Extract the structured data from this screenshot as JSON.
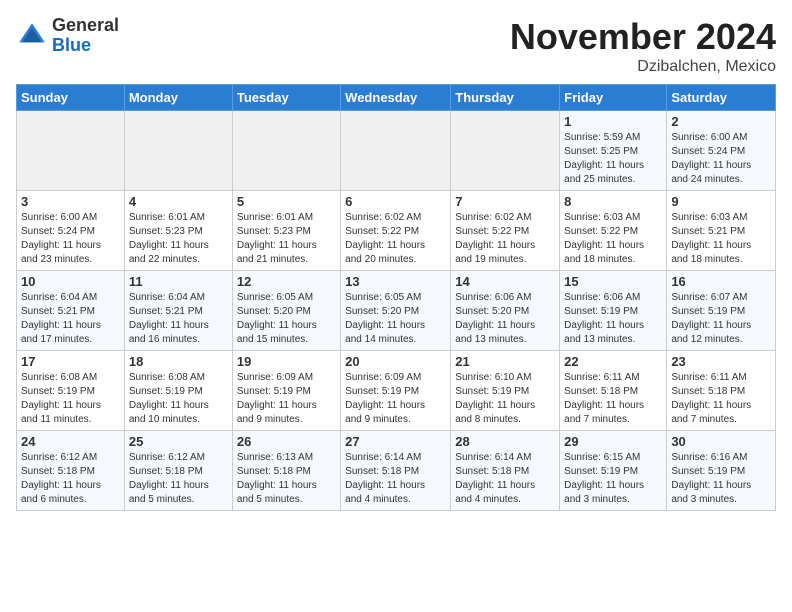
{
  "logo": {
    "general": "General",
    "blue": "Blue"
  },
  "title": "November 2024",
  "location": "Dzibalchen, Mexico",
  "days_header": [
    "Sunday",
    "Monday",
    "Tuesday",
    "Wednesday",
    "Thursday",
    "Friday",
    "Saturday"
  ],
  "weeks": [
    [
      {
        "day": "",
        "info": ""
      },
      {
        "day": "",
        "info": ""
      },
      {
        "day": "",
        "info": ""
      },
      {
        "day": "",
        "info": ""
      },
      {
        "day": "",
        "info": ""
      },
      {
        "day": "1",
        "info": "Sunrise: 5:59 AM\nSunset: 5:25 PM\nDaylight: 11 hours\nand 25 minutes."
      },
      {
        "day": "2",
        "info": "Sunrise: 6:00 AM\nSunset: 5:24 PM\nDaylight: 11 hours\nand 24 minutes."
      }
    ],
    [
      {
        "day": "3",
        "info": "Sunrise: 6:00 AM\nSunset: 5:24 PM\nDaylight: 11 hours\nand 23 minutes."
      },
      {
        "day": "4",
        "info": "Sunrise: 6:01 AM\nSunset: 5:23 PM\nDaylight: 11 hours\nand 22 minutes."
      },
      {
        "day": "5",
        "info": "Sunrise: 6:01 AM\nSunset: 5:23 PM\nDaylight: 11 hours\nand 21 minutes."
      },
      {
        "day": "6",
        "info": "Sunrise: 6:02 AM\nSunset: 5:22 PM\nDaylight: 11 hours\nand 20 minutes."
      },
      {
        "day": "7",
        "info": "Sunrise: 6:02 AM\nSunset: 5:22 PM\nDaylight: 11 hours\nand 19 minutes."
      },
      {
        "day": "8",
        "info": "Sunrise: 6:03 AM\nSunset: 5:22 PM\nDaylight: 11 hours\nand 18 minutes."
      },
      {
        "day": "9",
        "info": "Sunrise: 6:03 AM\nSunset: 5:21 PM\nDaylight: 11 hours\nand 18 minutes."
      }
    ],
    [
      {
        "day": "10",
        "info": "Sunrise: 6:04 AM\nSunset: 5:21 PM\nDaylight: 11 hours\nand 17 minutes."
      },
      {
        "day": "11",
        "info": "Sunrise: 6:04 AM\nSunset: 5:21 PM\nDaylight: 11 hours\nand 16 minutes."
      },
      {
        "day": "12",
        "info": "Sunrise: 6:05 AM\nSunset: 5:20 PM\nDaylight: 11 hours\nand 15 minutes."
      },
      {
        "day": "13",
        "info": "Sunrise: 6:05 AM\nSunset: 5:20 PM\nDaylight: 11 hours\nand 14 minutes."
      },
      {
        "day": "14",
        "info": "Sunrise: 6:06 AM\nSunset: 5:20 PM\nDaylight: 11 hours\nand 13 minutes."
      },
      {
        "day": "15",
        "info": "Sunrise: 6:06 AM\nSunset: 5:19 PM\nDaylight: 11 hours\nand 13 minutes."
      },
      {
        "day": "16",
        "info": "Sunrise: 6:07 AM\nSunset: 5:19 PM\nDaylight: 11 hours\nand 12 minutes."
      }
    ],
    [
      {
        "day": "17",
        "info": "Sunrise: 6:08 AM\nSunset: 5:19 PM\nDaylight: 11 hours\nand 11 minutes."
      },
      {
        "day": "18",
        "info": "Sunrise: 6:08 AM\nSunset: 5:19 PM\nDaylight: 11 hours\nand 10 minutes."
      },
      {
        "day": "19",
        "info": "Sunrise: 6:09 AM\nSunset: 5:19 PM\nDaylight: 11 hours\nand 9 minutes."
      },
      {
        "day": "20",
        "info": "Sunrise: 6:09 AM\nSunset: 5:19 PM\nDaylight: 11 hours\nand 9 minutes."
      },
      {
        "day": "21",
        "info": "Sunrise: 6:10 AM\nSunset: 5:19 PM\nDaylight: 11 hours\nand 8 minutes."
      },
      {
        "day": "22",
        "info": "Sunrise: 6:11 AM\nSunset: 5:18 PM\nDaylight: 11 hours\nand 7 minutes."
      },
      {
        "day": "23",
        "info": "Sunrise: 6:11 AM\nSunset: 5:18 PM\nDaylight: 11 hours\nand 7 minutes."
      }
    ],
    [
      {
        "day": "24",
        "info": "Sunrise: 6:12 AM\nSunset: 5:18 PM\nDaylight: 11 hours\nand 6 minutes."
      },
      {
        "day": "25",
        "info": "Sunrise: 6:12 AM\nSunset: 5:18 PM\nDaylight: 11 hours\nand 5 minutes."
      },
      {
        "day": "26",
        "info": "Sunrise: 6:13 AM\nSunset: 5:18 PM\nDaylight: 11 hours\nand 5 minutes."
      },
      {
        "day": "27",
        "info": "Sunrise: 6:14 AM\nSunset: 5:18 PM\nDaylight: 11 hours\nand 4 minutes."
      },
      {
        "day": "28",
        "info": "Sunrise: 6:14 AM\nSunset: 5:18 PM\nDaylight: 11 hours\nand 4 minutes."
      },
      {
        "day": "29",
        "info": "Sunrise: 6:15 AM\nSunset: 5:19 PM\nDaylight: 11 hours\nand 3 minutes."
      },
      {
        "day": "30",
        "info": "Sunrise: 6:16 AM\nSunset: 5:19 PM\nDaylight: 11 hours\nand 3 minutes."
      }
    ]
  ]
}
